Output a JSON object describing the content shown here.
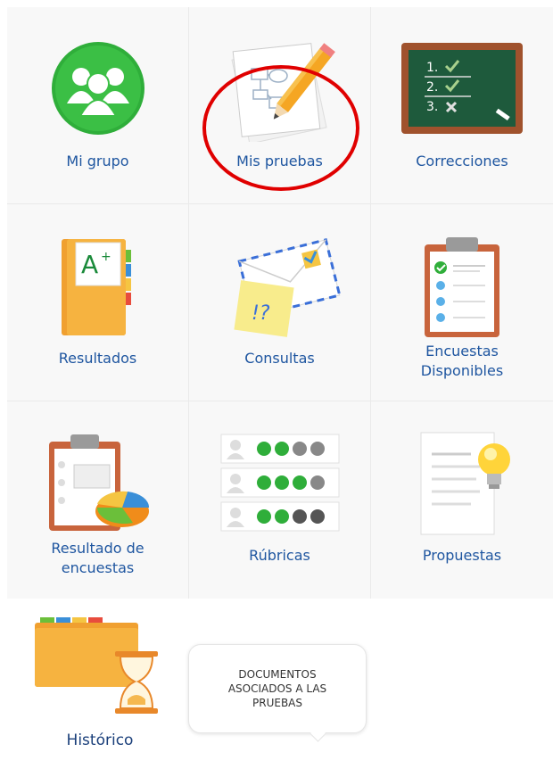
{
  "tiles": [
    {
      "label": "Mi grupo",
      "icon": "group-icon"
    },
    {
      "label": "Mis pruebas",
      "icon": "test-sheet-pencil-icon"
    },
    {
      "label": "Correcciones",
      "icon": "chalkboard-icon"
    },
    {
      "label": "Resultados",
      "icon": "grade-folder-icon"
    },
    {
      "label": "Consultas",
      "icon": "envelope-note-icon"
    },
    {
      "label": "Encuestas Disponibles",
      "icon": "clipboard-checklist-icon"
    },
    {
      "label": "Resultado de encuestas",
      "icon": "clipboard-pie-chart-icon"
    },
    {
      "label": "Rúbricas",
      "icon": "rubric-dots-icon"
    },
    {
      "label": "Propuestas",
      "icon": "document-lightbulb-icon"
    },
    {
      "label": "Histórico",
      "icon": "folder-hourglass-icon"
    }
  ],
  "chalkboard": {
    "line1": "1.",
    "line2": "2.",
    "line3": "3."
  },
  "grade": "A",
  "grade_sup": "+",
  "note_text": "!?",
  "tooltip": {
    "text": "DOCUMENTOS ASOCIADOS A LAS PRUEBAS"
  },
  "colors": {
    "label": "#1f56a0",
    "highlight": "#e00000"
  }
}
